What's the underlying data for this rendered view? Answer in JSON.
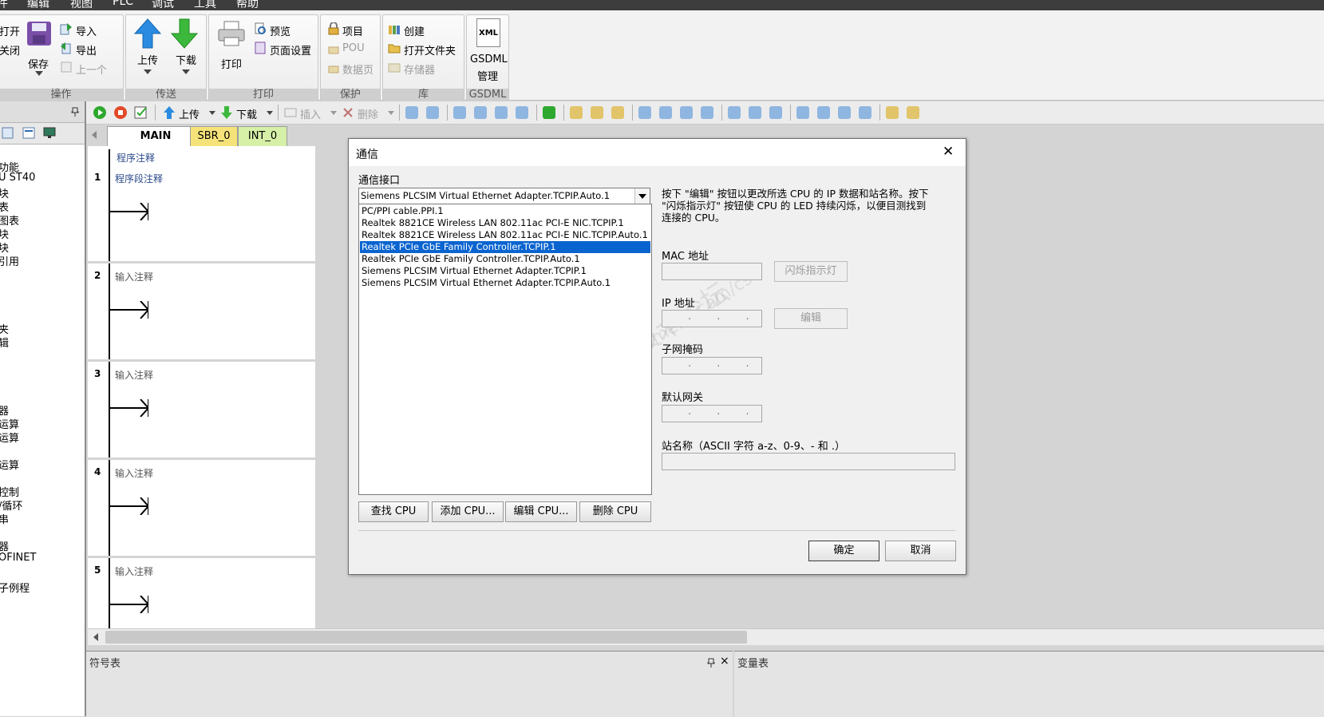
{
  "menu": [
    "件",
    "编辑",
    "视图",
    "PLC",
    "调试",
    "工具",
    "帮助"
  ],
  "ribbon": {
    "groups": {
      "operation": {
        "title": "操作",
        "open": "打开",
        "close": "关闭",
        "save": "保存",
        "import": "导入",
        "export": "导出",
        "previous": "上一个"
      },
      "transfer": {
        "title": "传送",
        "upload": "上传",
        "download": "下载"
      },
      "print": {
        "title": "打印",
        "print": "打印",
        "preview": "预览",
        "page_setup": "页面设置"
      },
      "protect": {
        "title": "保护",
        "project": "项目",
        "pou": "POU",
        "data_page": "数据页"
      },
      "library": {
        "title": "库",
        "create": "创建",
        "open_folder": "打开文件夹",
        "memory": "存储器"
      },
      "gsdml": {
        "title": "GSDML",
        "label1": "GSDML",
        "label2": "管理",
        "xml_badge": "XML"
      }
    }
  },
  "tree": {
    "items": [
      "功能",
      "U ST40",
      "块",
      "表",
      "图表",
      "块",
      "块",
      "引用",
      "夹",
      "辑",
      "器",
      "运算",
      "运算",
      "运算",
      "控制",
      "/循环",
      "串",
      "器",
      "OFINET",
      "子例程"
    ]
  },
  "toolbar": {
    "upload": "上传",
    "download": "下载",
    "insert": "插入",
    "delete": "删除"
  },
  "tabs": [
    {
      "label": "MAIN",
      "close": "×"
    },
    {
      "label": "SBR_0"
    },
    {
      "label": "INT_0"
    }
  ],
  "ladder": {
    "program_comment": "程序注释",
    "rungs": [
      {
        "num": "1",
        "comment": "程序段注释"
      },
      {
        "num": "2",
        "comment": "输入注释"
      },
      {
        "num": "3",
        "comment": "输入注释"
      },
      {
        "num": "4",
        "comment": "输入注释"
      },
      {
        "num": "5",
        "comment": "输入注释"
      }
    ]
  },
  "bottom_panels": {
    "symbol_table": "符号表",
    "variable_table": "变量表",
    "pin": "ᵖ",
    "close": "×"
  },
  "dialog": {
    "title": "通信",
    "close": "✕",
    "interface_label": "通信接口",
    "selected_interface": "Siemens PLCSIM Virtual Ethernet Adapter.TCPIP.Auto.1",
    "interfaces": [
      "PC/PPI cable.PPI.1",
      "Realtek 8821CE Wireless LAN 802.11ac PCI-E NIC.TCPIP.1",
      "Realtek 8821CE Wireless LAN 802.11ac PCI-E NIC.TCPIP.Auto.1",
      "Realtek PCIe GbE Family Controller.TCPIP.1",
      "Realtek PCIe GbE Family Controller.TCPIP.Auto.1",
      "Siemens PLCSIM Virtual Ethernet Adapter.TCPIP.1",
      "Siemens PLCSIM Virtual Ethernet Adapter.TCPIP.Auto.1"
    ],
    "selected_index": 3,
    "help_lines": [
      "按下 \"编辑\" 按钮以更改所选 CPU 的 IP 数据和站名称。按下",
      "\"闪烁指示灯\" 按钮使 CPU 的 LED 持续闪烁，以便目测找到",
      "连接的 CPU。"
    ],
    "mac_label": "MAC 地址",
    "blink_button": "闪烁指示灯",
    "ip_label": "IP 地址",
    "ip_value": ". . .",
    "edit_button": "编辑",
    "subnet_label": "子网掩码",
    "subnet_value": ". . .",
    "gateway_label": "默认网关",
    "gateway_value": ". . .",
    "station_label": "站名称（ASCII 字符 a-z、0-9、- 和 .）",
    "buttons": {
      "find": "查找 CPU",
      "add": "添加 CPU...",
      "edit": "编辑 CPU...",
      "delete": "删除 CPU",
      "ok": "确定",
      "cancel": "取消"
    },
    "watermark_line1": "西门子工业  技术论坛",
    "watermark_line2": "support.industry.siemens.com/cs"
  }
}
